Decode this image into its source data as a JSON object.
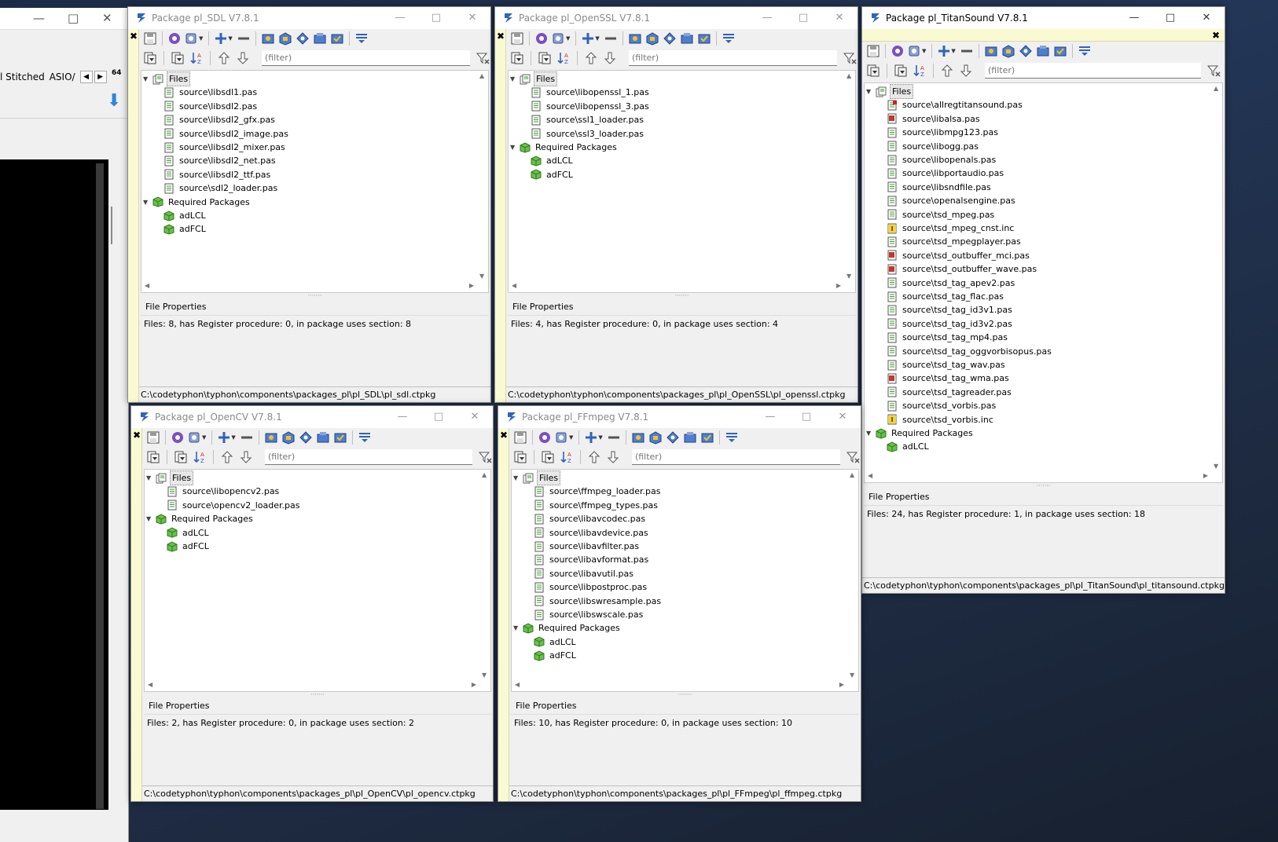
{
  "background_window": {
    "tab_stitched": "l Stitched",
    "tab_asio": "ASIO/",
    "badge_64": "64"
  },
  "filter_placeholder": "(filter)",
  "file_properties_label": "File Properties",
  "windows": {
    "sdl": {
      "title": "Package pl_SDL V7.8.1",
      "files_label": "Files",
      "files": [
        "source\\libsdl1.pas",
        "source\\libsdl2.pas",
        "source\\libsdl2_gfx.pas",
        "source\\libsdl2_image.pas",
        "source\\libsdl2_mixer.pas",
        "source\\libsdl2_net.pas",
        "source\\libsdl2_ttf.pas",
        "source\\sdl2_loader.pas"
      ],
      "req_label": "Required Packages",
      "required": [
        "adLCL",
        "adFCL"
      ],
      "props_text": "Files: 8, has Register procedure: 0, in package uses section: 8",
      "path": "C:\\codetyphon\\typhon\\components\\packages_pl\\pl_SDL\\pl_sdl.ctpkg"
    },
    "openssl": {
      "title": "Package pl_OpenSSL V7.8.1",
      "files_label": "Files",
      "files": [
        "source\\libopenssl_1.pas",
        "source\\libopenssl_3.pas",
        "source\\ssl1_loader.pas",
        "source\\ssl3_loader.pas"
      ],
      "req_label": "Required Packages",
      "required": [
        "adLCL",
        "adFCL"
      ],
      "props_text": "Files: 4, has Register procedure: 0, in package uses section: 4",
      "path": "C:\\codetyphon\\typhon\\components\\packages_pl\\pl_OpenSSL\\pl_openssl.ctpkg"
    },
    "titan": {
      "title": "Package pl_TitanSound V7.8.1",
      "files_label": "Files",
      "files": [
        "source\\allregtitansound.pas",
        "source\\libalsa.pas",
        "source\\libmpg123.pas",
        "source\\libogg.pas",
        "source\\libopenals.pas",
        "source\\libportaudio.pas",
        "source\\libsndfile.pas",
        "source\\openalsengine.pas",
        "source\\tsd_mpeg.pas",
        "source\\tsd_mpeg_cnst.inc",
        "source\\tsd_mpegplayer.pas",
        "source\\tsd_outbuffer_mci.pas",
        "source\\tsd_outbuffer_wave.pas",
        "source\\tsd_tag_apev2.pas",
        "source\\tsd_tag_flac.pas",
        "source\\tsd_tag_id3v1.pas",
        "source\\tsd_tag_id3v2.pas",
        "source\\tsd_tag_mp4.pas",
        "source\\tsd_tag_oggvorbisopus.pas",
        "source\\tsd_tag_wav.pas",
        "source\\tsd_tag_wma.pas",
        "source\\tsd_tagreader.pas",
        "source\\tsd_vorbis.pas",
        "source\\tsd_vorbis.inc"
      ],
      "file_icon_types": [
        "register",
        "red",
        "plain",
        "plain",
        "plain",
        "plain",
        "plain",
        "plain",
        "plain",
        "inc",
        "plain",
        "red",
        "red",
        "plain",
        "plain",
        "plain",
        "plain",
        "plain",
        "plain",
        "plain",
        "red",
        "plain",
        "plain",
        "inc"
      ],
      "req_label": "Required Packages",
      "required": [
        "adLCL"
      ],
      "props_text": "Files: 24, has Register procedure: 1, in package uses section: 18",
      "path": "C:\\codetyphon\\typhon\\components\\packages_pl\\pl_TitanSound\\pl_titansound.ctpkg"
    },
    "opencv": {
      "title": "Package pl_OpenCV V7.8.1",
      "files_label": "Files",
      "files": [
        "source\\libopencv2.pas",
        "source\\opencv2_loader.pas"
      ],
      "req_label": "Required Packages",
      "required": [
        "adLCL",
        "adFCL"
      ],
      "props_text": "Files: 2, has Register procedure: 0, in package uses section: 2",
      "path": "C:\\codetyphon\\typhon\\components\\packages_pl\\pl_OpenCV\\pl_opencv.ctpkg"
    },
    "ffmpeg": {
      "title": "Package pl_FFmpeg V7.8.1",
      "files_label": "Files",
      "files": [
        "source\\ffmpeg_loader.pas",
        "source\\ffmpeg_types.pas",
        "source\\libavcodec.pas",
        "source\\libavdevice.pas",
        "source\\libavfilter.pas",
        "source\\libavformat.pas",
        "source\\libavutil.pas",
        "source\\libpostproc.pas",
        "source\\libswresample.pas",
        "source\\libswscale.pas"
      ],
      "req_label": "Required Packages",
      "required": [
        "adLCL",
        "adFCL"
      ],
      "props_text": "Files: 10, has Register procedure: 0, in package uses section: 10",
      "path": "C:\\codetyphon\\typhon\\components\\packages_pl\\pl_FFmpeg\\pl_ffmpeg.ctpkg"
    }
  },
  "icons": {
    "toolbar": [
      "save-icon",
      "compile-icon",
      "options-icon",
      "add-icon",
      "remove-icon",
      "package-icon",
      "open-package-icon",
      "install-icon",
      "uninstall-icon",
      "use-icon",
      "more-icon"
    ],
    "filterrow": [
      "show-directory-hierarchy-icon",
      "sort-alphabetically-icon",
      "move-up-icon",
      "move-down-icon",
      "clear-filter-icon"
    ]
  },
  "colors": {
    "package_green": "#3f9c2e",
    "toolbar_blue": "#2f64b8",
    "inactive_title": "#8a8a8a",
    "yellow_bar": "#fafad2"
  }
}
